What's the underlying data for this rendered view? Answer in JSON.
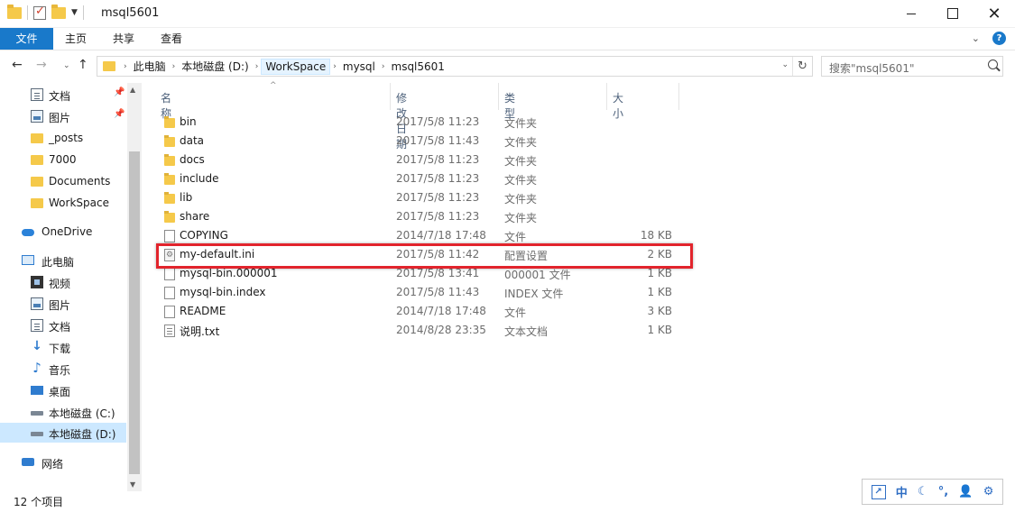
{
  "window": {
    "title": "msql5601",
    "controls": {
      "minimize": "",
      "maximize": "",
      "close": "✕"
    }
  },
  "ribbon": {
    "tabs": [
      {
        "label": "文件"
      },
      {
        "label": "主页"
      },
      {
        "label": "共享"
      },
      {
        "label": "查看"
      }
    ]
  },
  "address": {
    "crumbs": [
      {
        "label": "此电脑"
      },
      {
        "label": "本地磁盘 (D:)"
      },
      {
        "label": "WorkSpace"
      },
      {
        "label": "mysql"
      },
      {
        "label": "msql5601"
      }
    ]
  },
  "search": {
    "placeholder": "搜索\"msql5601\""
  },
  "sidebar": {
    "items": [
      {
        "label": "文档",
        "icon": "document-icon",
        "pinned": true
      },
      {
        "label": "图片",
        "icon": "picture-icon",
        "pinned": true
      },
      {
        "label": "_posts",
        "icon": "folder-icon"
      },
      {
        "label": "7000",
        "icon": "folder-icon"
      },
      {
        "label": "Documents",
        "icon": "folder-icon"
      },
      {
        "label": "WorkSpace",
        "icon": "folder-icon"
      },
      {
        "label": "OneDrive",
        "icon": "cloud-icon"
      },
      {
        "label": "此电脑",
        "icon": "computer-icon"
      },
      {
        "label": "视频",
        "icon": "video-icon"
      },
      {
        "label": "图片",
        "icon": "picture-icon"
      },
      {
        "label": "文档",
        "icon": "document-icon"
      },
      {
        "label": "下载",
        "icon": "download-icon"
      },
      {
        "label": "音乐",
        "icon": "music-icon"
      },
      {
        "label": "桌面",
        "icon": "desktop-icon"
      },
      {
        "label": "本地磁盘 (C:)",
        "icon": "drive-icon"
      },
      {
        "label": "本地磁盘 (D:)",
        "icon": "drive-icon",
        "selected": true
      },
      {
        "label": "网络",
        "icon": "network-icon"
      }
    ]
  },
  "filelist": {
    "columns": [
      {
        "label": "名称"
      },
      {
        "label": "修改日期"
      },
      {
        "label": "类型"
      },
      {
        "label": "大小"
      }
    ],
    "rows": [
      {
        "name": "bin",
        "date": "2017/5/8 11:23",
        "type": "文件夹",
        "size": "",
        "icon": "folder"
      },
      {
        "name": "data",
        "date": "2017/5/8 11:43",
        "type": "文件夹",
        "size": "",
        "icon": "folder"
      },
      {
        "name": "docs",
        "date": "2017/5/8 11:23",
        "type": "文件夹",
        "size": "",
        "icon": "folder"
      },
      {
        "name": "include",
        "date": "2017/5/8 11:23",
        "type": "文件夹",
        "size": "",
        "icon": "folder"
      },
      {
        "name": "lib",
        "date": "2017/5/8 11:23",
        "type": "文件夹",
        "size": "",
        "icon": "folder"
      },
      {
        "name": "share",
        "date": "2017/5/8 11:23",
        "type": "文件夹",
        "size": "",
        "icon": "folder"
      },
      {
        "name": "COPYING",
        "date": "2014/7/18 17:48",
        "type": "文件",
        "size": "18 KB",
        "icon": "file"
      },
      {
        "name": "my-default.ini",
        "date": "2017/5/8 11:42",
        "type": "配置设置",
        "size": "2 KB",
        "icon": "ini",
        "highlighted": true
      },
      {
        "name": "mysql-bin.000001",
        "date": "2017/5/8 13:41",
        "type": "000001 文件",
        "size": "1 KB",
        "icon": "file"
      },
      {
        "name": "mysql-bin.index",
        "date": "2017/5/8 11:43",
        "type": "INDEX 文件",
        "size": "1 KB",
        "icon": "file"
      },
      {
        "name": "README",
        "date": "2014/7/18 17:48",
        "type": "文件",
        "size": "3 KB",
        "icon": "file"
      },
      {
        "name": "说明.txt",
        "date": "2014/8/28 23:35",
        "type": "文本文档",
        "size": "1 KB",
        "icon": "text"
      }
    ]
  },
  "status": {
    "count": "12 个项目"
  },
  "ime": {
    "mode": "中"
  },
  "colors": {
    "accent": "#1979ca",
    "highlight_border": "#e2242c",
    "selection": "#cce8ff"
  }
}
